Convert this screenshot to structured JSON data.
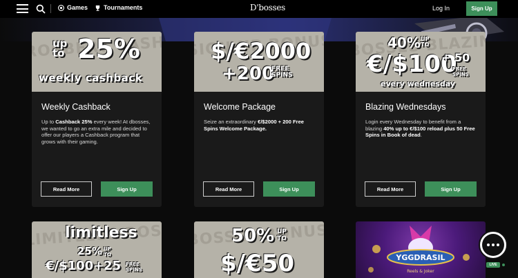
{
  "header": {
    "nav": {
      "games": "Games",
      "tournaments": "Tournaments"
    },
    "logo": "D'bosses",
    "login": "Log In",
    "signup": "Sign Up"
  },
  "promotions": [
    {
      "banner": {
        "line1a": "up to",
        "line1b": "25%",
        "line2": "weekly cashback",
        "watermark": "ROBBERY CASHBACK"
      },
      "title": "Weekly Cashback",
      "desc_parts": [
        "Up to ",
        "Cashback 25%",
        " every week! At dbosses, we wanted to go an extra mile and decided to offer our players a Cashback program that grows with their gaming."
      ],
      "read_more": "Read More",
      "sign_up": "Sign Up"
    },
    {
      "banner": {
        "line1": "$/€2000",
        "line2a": "+200",
        "line2b": "FREE SPINS",
        "watermark": "SIGN UP BONUS"
      },
      "title": "Welcome Package",
      "desc_parts": [
        "Seize an extraordinary ",
        "€/$2000 + 200 Free Spins Welcome Package.",
        ""
      ],
      "read_more": "Read More",
      "sign_up": "Sign Up"
    },
    {
      "banner": {
        "line1a": "40%",
        "line1b": "UP TO",
        "line2a": "€/$100",
        "line2b": "+ 50",
        "line2c": "FREE SPINS",
        "line3": "every wednesday",
        "watermark": "BOSSES BLAZING"
      },
      "title": "Blazing Wednesdays",
      "desc_parts": [
        "Login every Wednesday to benefit from a blazing ",
        "40% up to €/$100 reload plus 50 Free Spins in Book of dead",
        "."
      ],
      "read_more": "Read More",
      "sign_up": "Sign Up"
    },
    {
      "banner": {
        "line1": "limitless",
        "line2a": "25%",
        "line2b": "UP TO",
        "line3a": "€/$100+",
        "line3b": "25",
        "line3c": "FREE SPINS",
        "watermark": "LIMITLESS BOSS"
      }
    },
    {
      "banner": {
        "line1a": "50%",
        "line1b": "UP TO",
        "line2": "$/€50",
        "watermark": "BOSSES BONUS"
      }
    },
    {
      "banner": {
        "title": "YGGDRASIL",
        "sub": "Reels & Joker"
      }
    }
  ],
  "chat": {
    "live": "LIVE"
  }
}
